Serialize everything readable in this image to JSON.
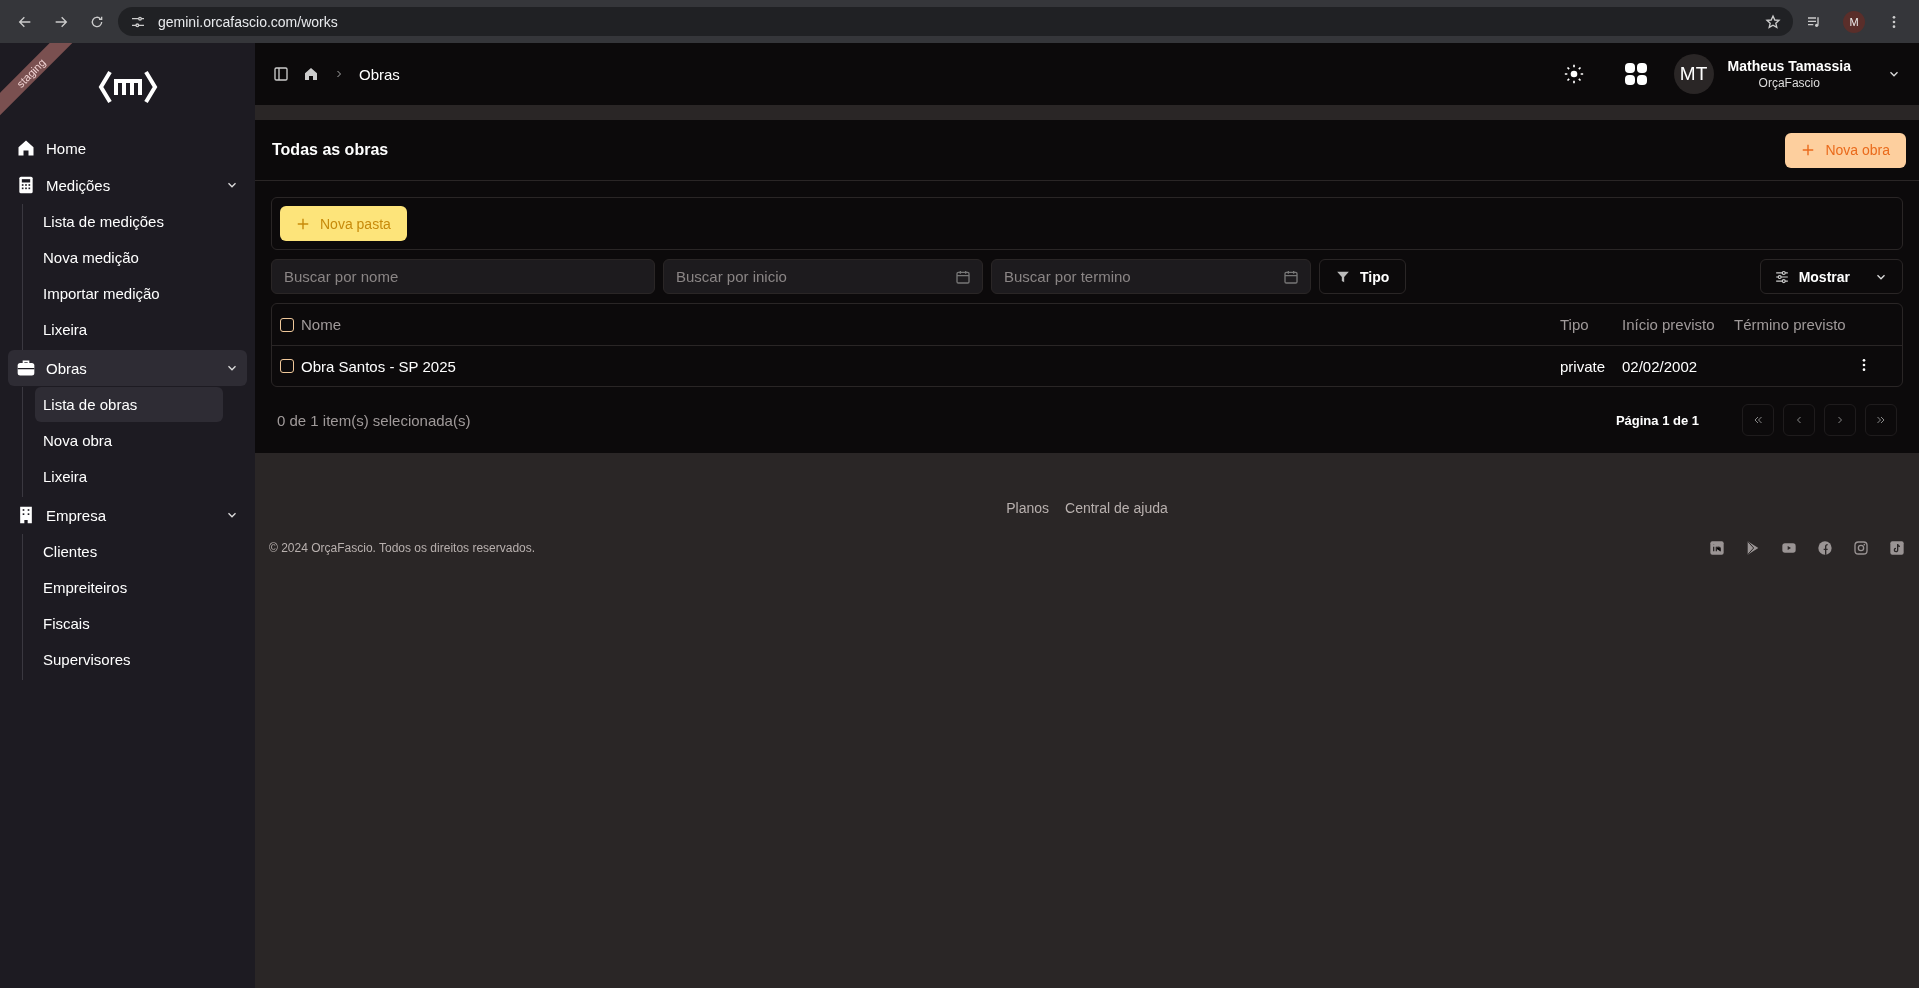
{
  "browser": {
    "url": "gemini.orcafascio.com/works",
    "profile_initial": "M"
  },
  "sidebar": {
    "env_badge": "staging",
    "items": [
      {
        "label": "Home",
        "kind": "home",
        "selected": false
      },
      {
        "label": "Medições",
        "kind": "calculator",
        "selected": false,
        "expanded": true,
        "children": [
          {
            "label": "Lista de medições",
            "selected": false
          },
          {
            "label": "Nova medição",
            "selected": false
          },
          {
            "label": "Importar medição",
            "selected": false
          },
          {
            "label": "Lixeira",
            "selected": false
          }
        ]
      },
      {
        "label": "Obras",
        "kind": "briefcase",
        "selected": true,
        "expanded": true,
        "children": [
          {
            "label": "Lista de obras",
            "selected": true
          },
          {
            "label": "Nova obra",
            "selected": false
          },
          {
            "label": "Lixeira",
            "selected": false
          }
        ]
      },
      {
        "label": "Empresa",
        "kind": "building",
        "selected": false,
        "expanded": true,
        "children": [
          {
            "label": "Clientes",
            "selected": false
          },
          {
            "label": "Empreiteiros",
            "selected": false
          },
          {
            "label": "Fiscais",
            "selected": false
          },
          {
            "label": "Supervisores",
            "selected": false
          }
        ]
      }
    ]
  },
  "header": {
    "breadcrumb": "Obras",
    "user": {
      "initials": "MT",
      "name": "Matheus Tamassia",
      "org": "OrçaFascio"
    }
  },
  "page": {
    "title": "Todas as obras",
    "new_button": "Nova obra",
    "folder_button": "Nova pasta",
    "filters": {
      "name_placeholder": "Buscar por nome",
      "start_placeholder": "Buscar por inicio",
      "end_placeholder": "Buscar por termino",
      "type_button": "Tipo",
      "show_button": "Mostrar"
    },
    "table": {
      "columns": [
        "Nome",
        "Tipo",
        "Início previsto",
        "Término previsto"
      ],
      "all_checked": false,
      "rows": [
        {
          "checked": false,
          "cells": [
            "Obra Santos - SP 2025",
            "private",
            "02/02/2002",
            ""
          ]
        }
      ]
    },
    "selection": "0 de 1 item(s) selecionada(s)",
    "pagination": "Página 1 de 1"
  },
  "footer": {
    "links": [
      "Planos",
      "Central de ajuda"
    ],
    "copyright": "© 2024 OrçaFascio. Todos os direitos reservados."
  }
}
